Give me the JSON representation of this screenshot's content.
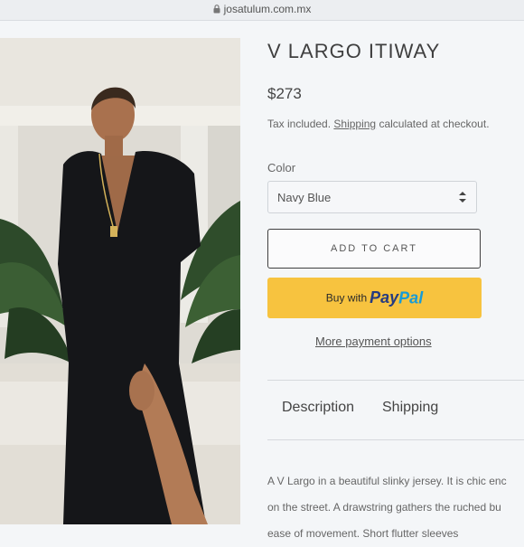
{
  "browser": {
    "url": "josatulum.com.mx"
  },
  "product": {
    "title": "V LARGO ITIWAY",
    "price": "$273",
    "tax_text": "Tax included.",
    "shipping_link": "Shipping",
    "tax_suffix": "calculated at checkout.",
    "color_label": "Color",
    "color_value": "Navy Blue",
    "add_to_cart": "ADD TO CART",
    "paypal_prefix": "Buy with",
    "paypal_pay": "Pay",
    "paypal_pal": "Pal",
    "more_payment": "More payment options"
  },
  "tabs": [
    {
      "label": "Description"
    },
    {
      "label": "Shipping"
    }
  ],
  "description": {
    "lines": [
      "A V Largo in a beautiful slinky jersey. It is chic enc",
      "on the street. A drawstring gathers the ruched bu",
      "ease of movement. Short flutter sleeves"
    ]
  },
  "icons": {
    "lock": "lock-icon",
    "select": "select-chevron-icon"
  },
  "colors": {
    "paypal_bg": "#f7c33f",
    "paypal_blue_dark": "#253b80",
    "paypal_blue_light": "#179bd7"
  }
}
